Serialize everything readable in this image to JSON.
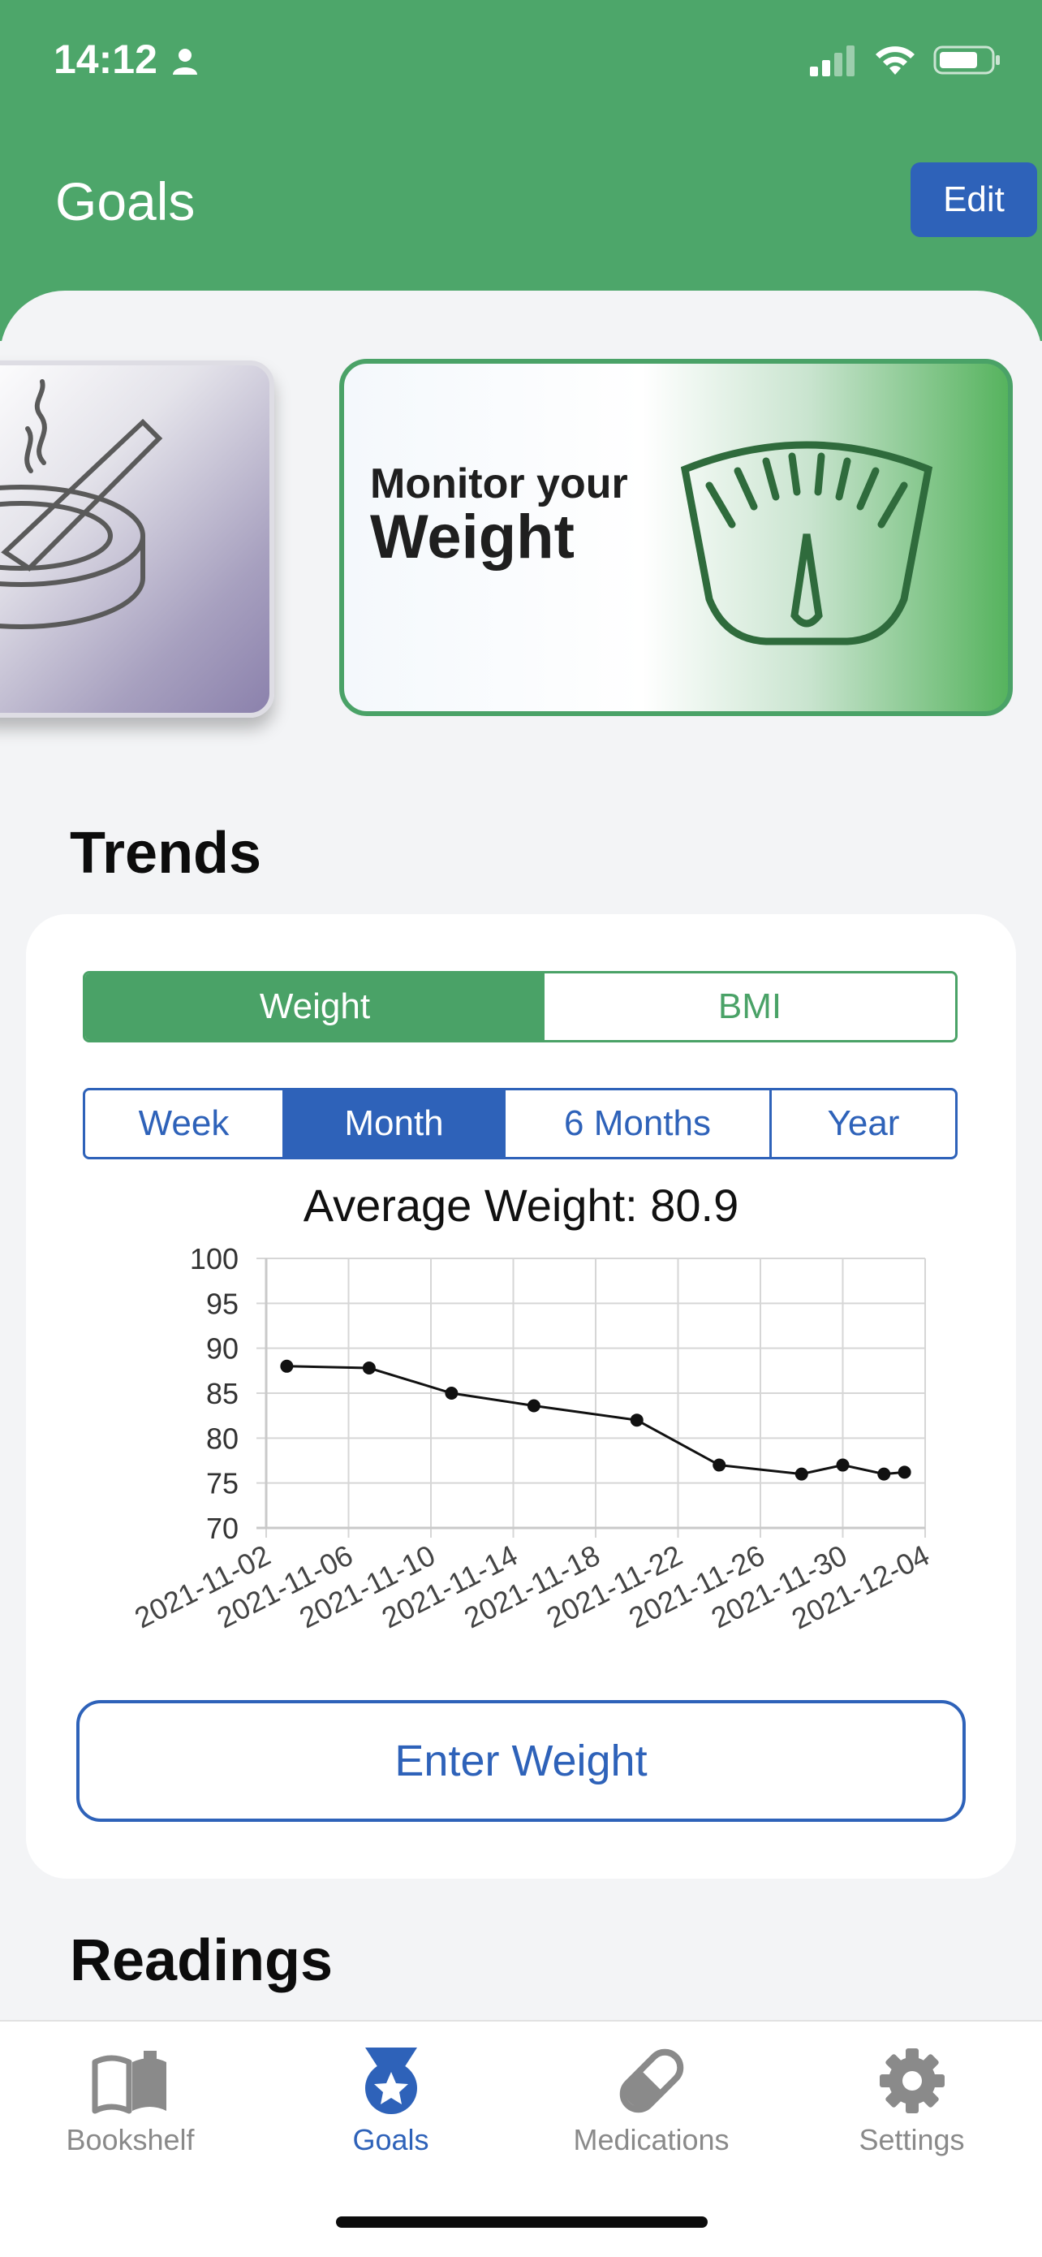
{
  "status_bar": {
    "time": "14:12",
    "icons": [
      "person-icon",
      "cellular-signal-icon",
      "wifi-icon",
      "battery-icon"
    ]
  },
  "header": {
    "title": "Goals",
    "edit_label": "Edit"
  },
  "goal_cards": [
    {
      "name": "quit-smoking",
      "icon": "ashtray-cigarette-icon"
    },
    {
      "name": "monitor-weight",
      "line1": "Monitor your",
      "line2": "Weight",
      "icon": "scale-icon"
    }
  ],
  "trends": {
    "title": "Trends",
    "metric_tabs": [
      "Weight",
      "BMI"
    ],
    "metric_selected": "Weight",
    "range_tabs": [
      "Week",
      "Month",
      "6 Months",
      "Year"
    ],
    "range_selected": "Month",
    "average_label": "Average Weight: 80.9",
    "enter_button": "Enter Weight"
  },
  "chart_data": {
    "type": "line",
    "title": "Average Weight: 80.9",
    "xlabel": "",
    "ylabel": "",
    "xlim": [
      "2021-11-02",
      "2021-12-04"
    ],
    "ylim": [
      70,
      100
    ],
    "y_ticks": [
      100,
      95,
      90,
      85,
      80,
      75,
      70
    ],
    "x_ticks": [
      "2021-11-02",
      "2021-11-06",
      "2021-11-10",
      "2021-11-14",
      "2021-11-18",
      "2021-11-22",
      "2021-11-26",
      "2021-11-30",
      "2021-12-04"
    ],
    "grid": true,
    "series": [
      {
        "x": [
          "2021-11-03",
          "2021-11-07",
          "2021-11-11",
          "2021-11-15",
          "2021-11-20",
          "2021-11-24",
          "2021-11-28",
          "2021-11-30",
          "2021-12-02",
          "2021-12-03"
        ],
        "y": [
          88,
          87.8,
          85,
          83.6,
          82,
          77,
          76,
          77,
          76,
          76.2
        ]
      }
    ]
  },
  "readings": {
    "title": "Readings"
  },
  "tab_bar": {
    "items": [
      {
        "label": "Bookshelf",
        "icon": "book-icon"
      },
      {
        "label": "Goals",
        "icon": "medal-icon"
      },
      {
        "label": "Medications",
        "icon": "pill-icon"
      },
      {
        "label": "Settings",
        "icon": "gear-icon"
      }
    ],
    "active": "Goals"
  },
  "colors": {
    "header_green": "#4da66a",
    "accent_blue": "#2e62b9",
    "accent_green": "#4aa267",
    "inactive_gray": "#8a8a8a"
  }
}
